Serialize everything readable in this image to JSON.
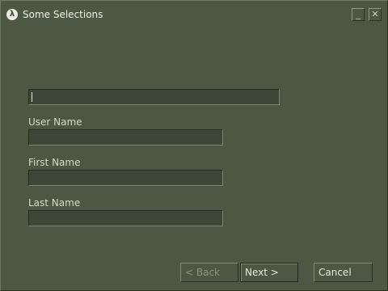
{
  "window": {
    "title": "Some Selections",
    "app_icon_glyph": "λ",
    "minimize_glyph": "_",
    "close_glyph": "✕"
  },
  "form": {
    "top_field_value": "",
    "username_label": "User Name",
    "username_value": "",
    "firstname_label": "First Name",
    "firstname_value": "",
    "lastname_label": "Last Name",
    "lastname_value": ""
  },
  "buttons": {
    "back": "< Back",
    "next": "Next >",
    "cancel": "Cancel"
  },
  "colors": {
    "background": "#4c5844",
    "field_bg": "#3e4737",
    "text": "#d8dccf",
    "disabled_text": "#8a9280"
  }
}
